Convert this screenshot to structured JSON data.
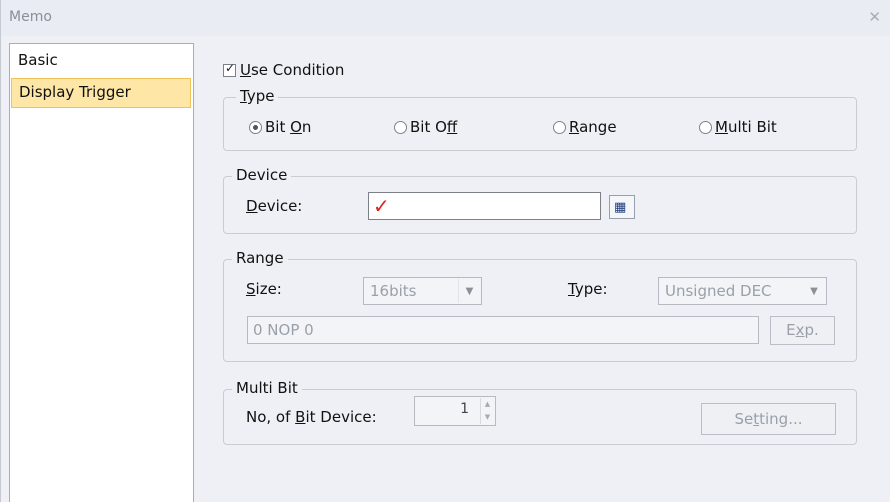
{
  "window": {
    "title": "Memo",
    "close_icon": "close-icon"
  },
  "sidebar": {
    "items": [
      {
        "label": "Basic",
        "selected": false
      },
      {
        "label": "Display Trigger",
        "selected": true
      }
    ]
  },
  "use_condition": {
    "label_first": "U",
    "label_rest": "se Condition",
    "checked": true
  },
  "type_group": {
    "legend_first": "T",
    "legend_rest": "ype",
    "options": [
      {
        "pre": "Bit ",
        "u": "O",
        "post": "n",
        "selected": true
      },
      {
        "pre": "Bit O",
        "u": "f",
        "post": "f",
        "selected": false
      },
      {
        "pre": "",
        "u": "R",
        "post": "ange",
        "selected": false
      },
      {
        "pre": "",
        "u": "M",
        "post": "ulti Bit",
        "selected": false
      }
    ]
  },
  "device_group": {
    "legend": "Device",
    "label_first": "D",
    "label_rest": "evice:",
    "value_icon": "red-checkmark-icon",
    "browse_icon": "device-browse-icon",
    "colors": {
      "checkmark": "#e0201b"
    }
  },
  "range_group": {
    "legend": "Range",
    "size_label_first": "S",
    "size_label_rest": "ize:",
    "size_value": "16bits",
    "type_label_first": "T",
    "type_label_rest": "ype:",
    "type_value": "Unsigned DEC",
    "expression": "0 NOP 0",
    "exp_pre": "E",
    "exp_u": "x",
    "exp_post": "p."
  },
  "multibit_group": {
    "legend": "Multi Bit",
    "label_pre": "No, of ",
    "label_u": "B",
    "label_post": "it Device:",
    "count": "1",
    "setting_pre": "Se",
    "setting_u": "t",
    "setting_post": "ting..."
  },
  "colors": {
    "selection_bg": "#fde6a6",
    "selection_border": "#f0c25a",
    "window_bg": "#eef0f5"
  }
}
